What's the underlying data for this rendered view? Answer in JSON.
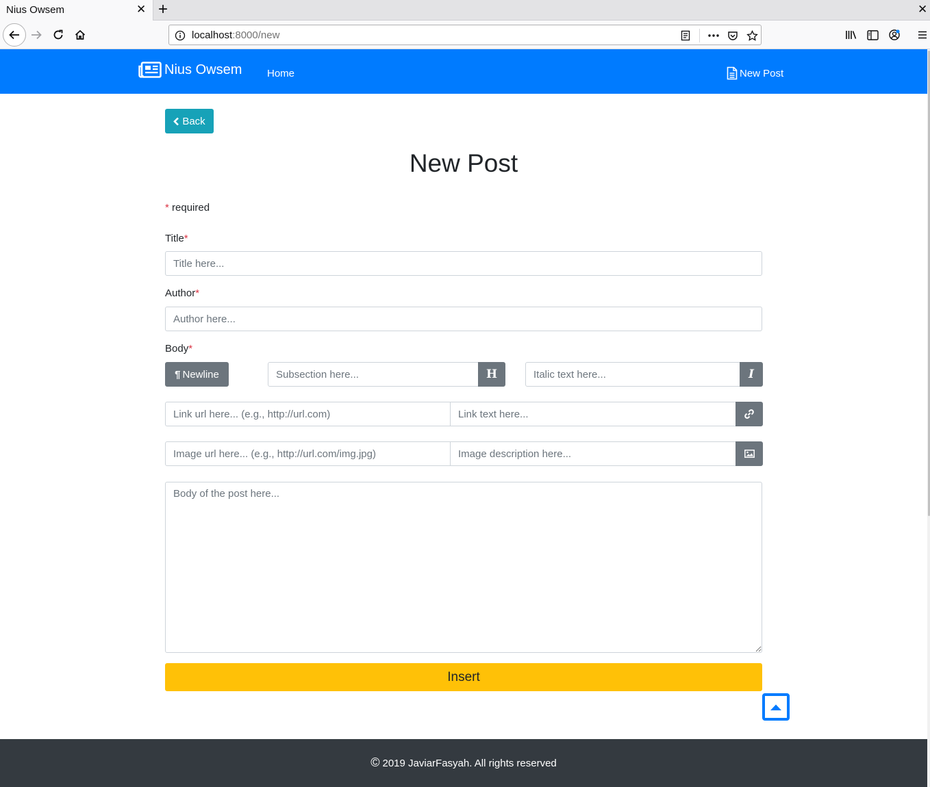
{
  "browser": {
    "tab_title": "Nius Owsem",
    "url_host": "localhost",
    "url_rest": ":8000/new"
  },
  "nav": {
    "brand": "Nius Owsem",
    "home": "Home",
    "new_post": "New Post"
  },
  "page": {
    "back_label": "Back",
    "title": "New Post",
    "required_star": "*",
    "required_text": "required"
  },
  "form": {
    "title_label": "Title",
    "title_placeholder": "Title here...",
    "author_label": "Author",
    "author_placeholder": "Author here...",
    "body_label": "Body",
    "newline_label": "Newline",
    "subsection_placeholder": "Subsection here...",
    "heading_btn": "H",
    "italic_placeholder": "Italic text here...",
    "italic_btn": "I",
    "link_url_placeholder": "Link url here... (e.g., http://url.com)",
    "link_text_placeholder": "Link text here...",
    "image_url_placeholder": "Image url here... (e.g., http://url.com/img.jpg)",
    "image_desc_placeholder": "Image description here...",
    "body_placeholder": "Body of the post here...",
    "insert_label": "Insert"
  },
  "footer": {
    "text": "2019 JaviarFasyah. All rights reserved"
  },
  "colors": {
    "primary": "#007bff",
    "info": "#17a2b8",
    "secondary": "#6c757d",
    "warning": "#ffc107",
    "dark": "#343a40",
    "danger": "#dc3545"
  }
}
